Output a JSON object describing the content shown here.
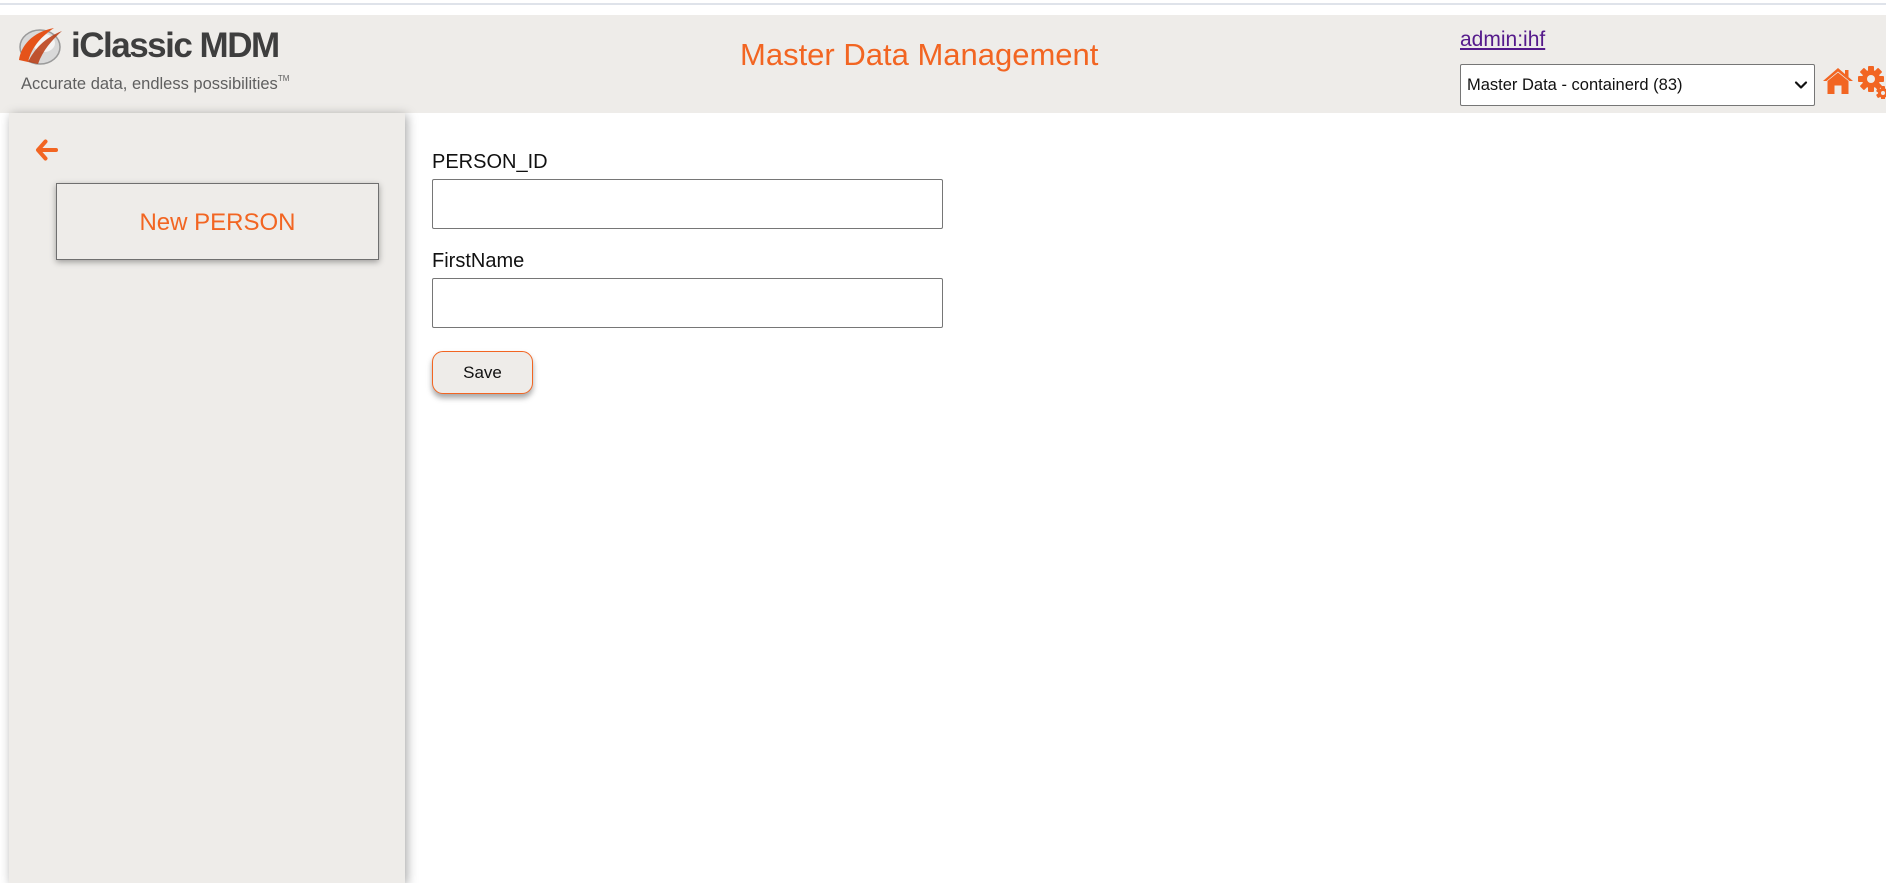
{
  "header": {
    "logo": {
      "brand": "iClassic MDM",
      "tagline": "Accurate data, endless possibilities",
      "trademark": "TM"
    },
    "title": "Master Data Management",
    "user_link": "admin:ihf",
    "container_select": {
      "selected": "Master Data - containerd (83)"
    },
    "icons": [
      "home-icon",
      "gear-icon"
    ]
  },
  "sidebar": {
    "back_icon": "arrow-left-icon",
    "items": [
      {
        "label": "New PERSON"
      }
    ]
  },
  "form": {
    "fields": [
      {
        "label": "PERSON_ID",
        "value": ""
      },
      {
        "label": "FirstName",
        "value": ""
      }
    ],
    "save_label": "Save"
  },
  "colors": {
    "accent": "#f26522",
    "panel": "#eeece9",
    "link": "#551a8b"
  }
}
